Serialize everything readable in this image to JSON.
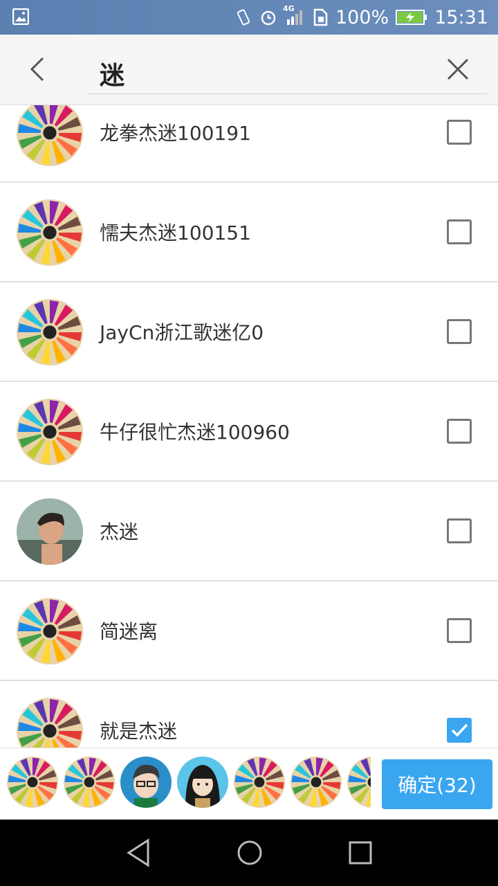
{
  "status_bar": {
    "battery": "100%",
    "time": "15:31",
    "network": "4G"
  },
  "search": {
    "query": "迷"
  },
  "contacts": [
    {
      "name": "龙拳杰迷100191",
      "avatar": "pencil-avatar",
      "checked": false
    },
    {
      "name": "懦夫杰迷100151",
      "avatar": "pencil-avatar",
      "checked": false
    },
    {
      "name": "JayCn浙江歌迷亿0",
      "avatar": "pencil-avatar",
      "checked": false
    },
    {
      "name": "牛仔很忙杰迷100960",
      "avatar": "pencil-avatar",
      "checked": false
    },
    {
      "name": "杰迷",
      "avatar": "photo-avatar",
      "checked": false
    },
    {
      "name": "简迷离",
      "avatar": "pencil-avatar",
      "checked": false
    },
    {
      "name": "就是杰迷",
      "avatar": "pencil-avatar",
      "checked": true
    }
  ],
  "selected_avatars": [
    "pencil-avatar",
    "pencil-avatar",
    "cartoon-boy-avatar",
    "cartoon-girl-avatar",
    "pencil-avatar",
    "pencil-avatar",
    "pencil-avatar"
  ],
  "confirm_button": {
    "label": "确定(32)"
  },
  "colors": {
    "accent": "#3aa6f0",
    "status_bar": "#5a7fb0"
  }
}
